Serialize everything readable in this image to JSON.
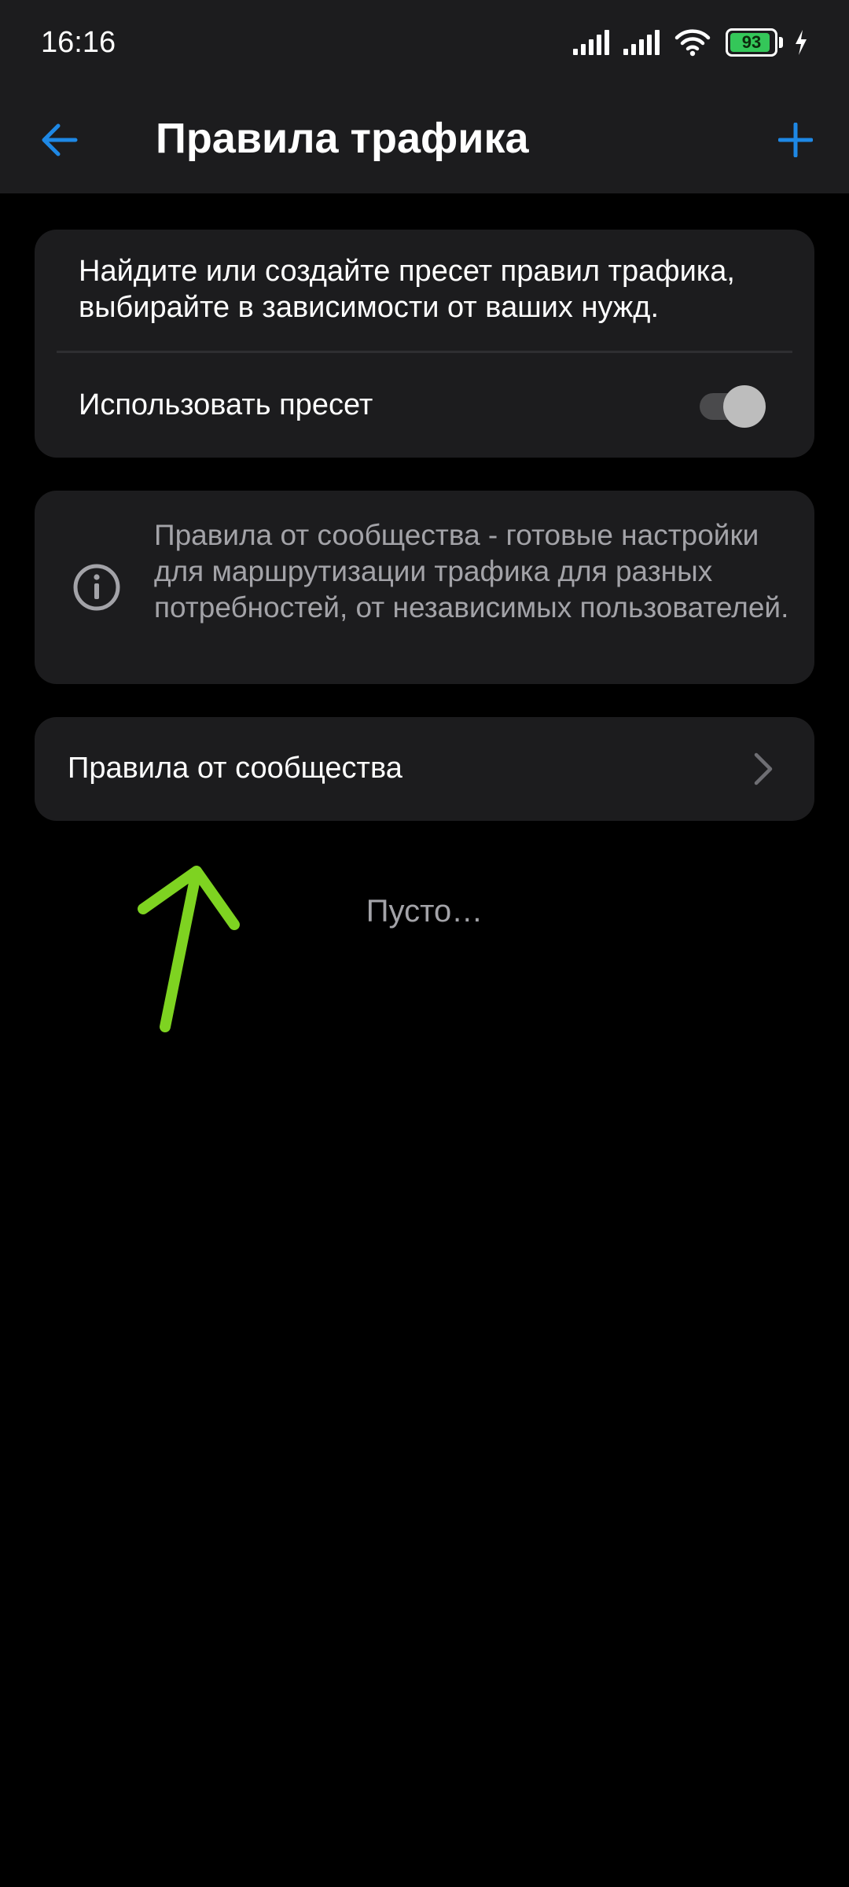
{
  "status_bar": {
    "time": "16:16",
    "battery_level": "93",
    "battery_percent": 93,
    "icons": [
      "signal-icon",
      "signal-icon",
      "wifi-icon",
      "battery-icon",
      "charging-icon"
    ]
  },
  "app_bar": {
    "title": "Правила трафика",
    "back_icon": "arrow-left-icon",
    "add_icon": "plus-icon"
  },
  "preset_card": {
    "description": "Найдите или создайте пресет правил трафика, выбирайте в зависимости от ваших нужд.",
    "toggle_label": "Использовать пресет",
    "toggle_on": false
  },
  "info_card": {
    "icon": "info-icon",
    "text": "Правила от сообщества - готовые настройки для маршрутизации трафика для разных потребностей, от независимых пользователей."
  },
  "community_item": {
    "label": "Правила от сообщества",
    "icon": "chevron-right-icon"
  },
  "empty_state": {
    "text": "Пусто…"
  },
  "colors": {
    "accent": "#1e88e5",
    "background": "#000000",
    "surface": "#1c1c1e",
    "secondary_text": "#a3a3a8",
    "annotation": "#7ed321",
    "battery": "#34c759"
  }
}
